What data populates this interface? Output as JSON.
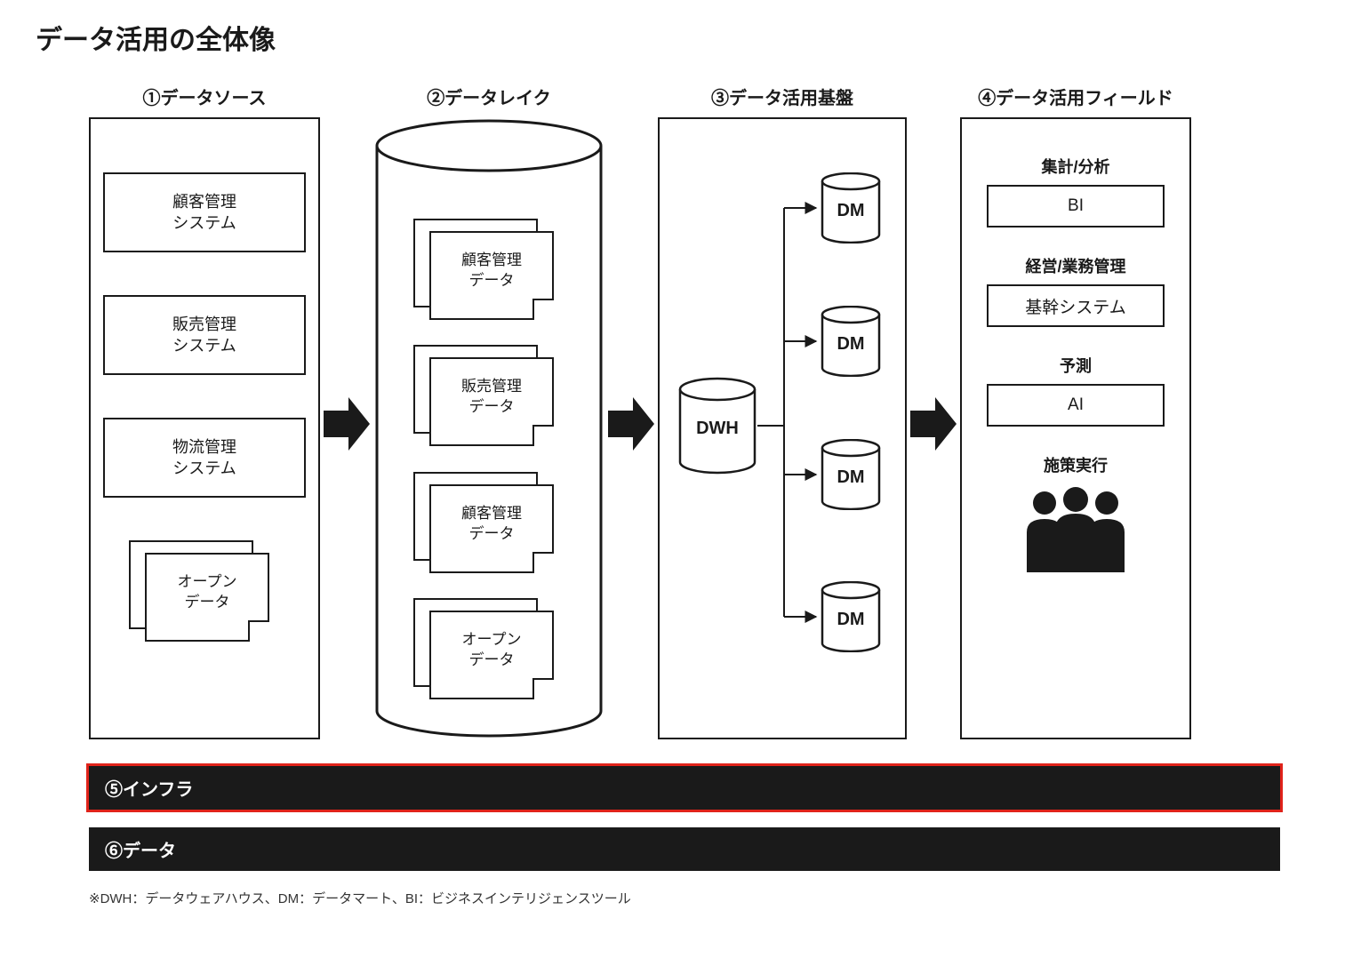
{
  "title": "データ活用の全体像",
  "columns": {
    "c1": {
      "header": "①データソース",
      "items": [
        "顧客管理\nシステム",
        "販売管理\nシステム",
        "物流管理\nシステム"
      ],
      "open_data": "オープン\nデータ"
    },
    "c2": {
      "header": "②データレイク",
      "docs": [
        "顧客管理\nデータ",
        "販売管理\nデータ",
        "顧客管理\nデータ",
        "オープン\nデータ"
      ]
    },
    "c3": {
      "header": "③データ活用基盤",
      "dwh": "DWH",
      "dm": "DM"
    },
    "c4": {
      "header": "④データ活用フィールド",
      "groups": [
        {
          "label": "集計/分析",
          "box": "BI"
        },
        {
          "label": "経営/業務管理",
          "box": "基幹システム"
        },
        {
          "label": "予測",
          "box": "AI"
        },
        {
          "label": "施策実行",
          "box": null
        }
      ]
    }
  },
  "bars": {
    "infra": "⑤インフラ",
    "data": "⑥データ"
  },
  "footnote": "※DWH：データウェアハウス、DM：データマート、BI：ビジネスインテリジェンスツール"
}
